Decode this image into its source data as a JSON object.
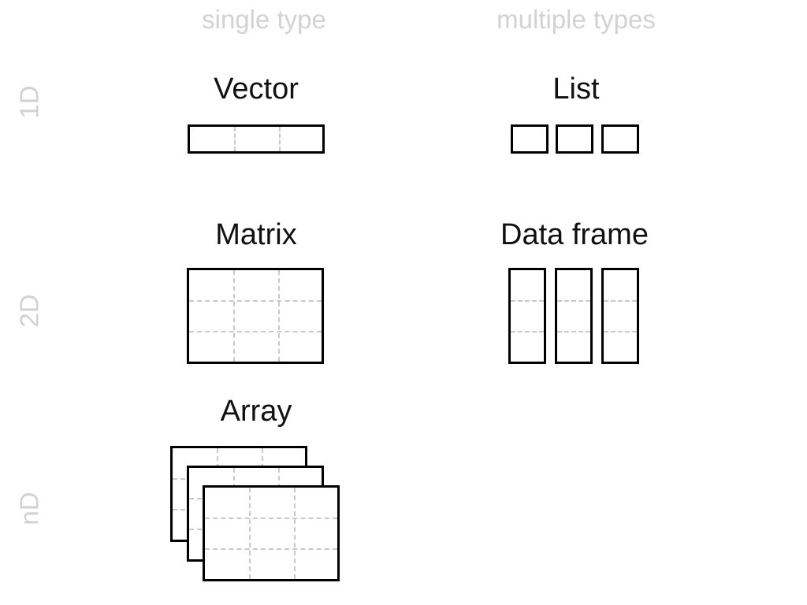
{
  "figure": {
    "background_color": "#ffffff",
    "outline_color": "#000000",
    "grid_color": "#c9c9c9",
    "muted_text_color": "#d2d2d2",
    "title_text_color": "#111111"
  },
  "columns": [
    {
      "id": "single",
      "label": "single type"
    },
    {
      "id": "multiple",
      "label": "multiple types"
    }
  ],
  "rows": [
    {
      "id": "1d",
      "label": "1D"
    },
    {
      "id": "2d",
      "label": "2D"
    },
    {
      "id": "nd",
      "label": "nD"
    }
  ],
  "cells": {
    "vector": {
      "title": "Vector",
      "row": "1D",
      "column": "single type",
      "shape_kind": "single-rectangle",
      "grid_columns": 3,
      "grid_rows": 1
    },
    "list": {
      "title": "List",
      "row": "1D",
      "column": "multiple types",
      "shape_kind": "separate-boxes",
      "box_count": 3,
      "grid_rows": 1
    },
    "matrix": {
      "title": "Matrix",
      "row": "2D",
      "column": "single type",
      "shape_kind": "single-rectangle",
      "grid_columns": 3,
      "grid_rows": 3
    },
    "dataframe": {
      "title": "Data frame",
      "row": "2D",
      "column": "multiple types",
      "shape_kind": "separate-columns",
      "box_count": 3,
      "grid_rows": 3
    },
    "array": {
      "title": "Array",
      "row": "nD",
      "column": "single type",
      "shape_kind": "stacked-rectangles",
      "layer_count": 3,
      "grid_columns": 3,
      "grid_rows": 3
    }
  }
}
